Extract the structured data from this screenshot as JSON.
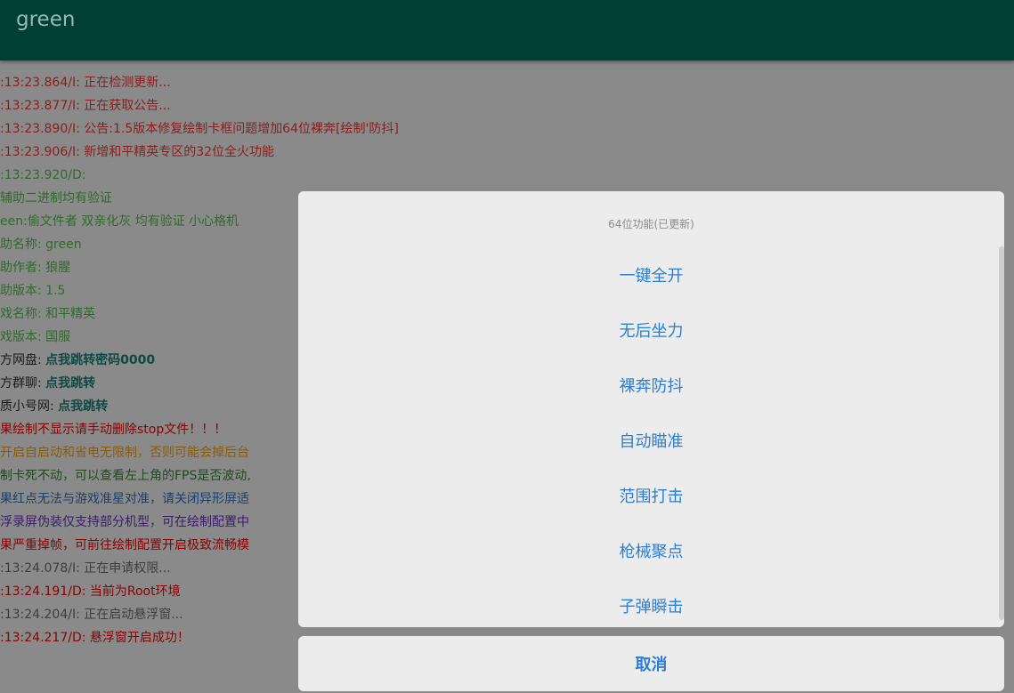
{
  "app": {
    "title": "green"
  },
  "log": [
    {
      "text": ":13:23.864/I: 正在检测更新...",
      "color": "#8b1d1d"
    },
    {
      "text": ":13:23.877/I: 正在获取公告...",
      "color": "#8b1d1d"
    },
    {
      "text": ":13:23.890/I: 公告:1.5版本修复绘制卡框问题增加64位裸奔[绘制'防抖]",
      "color": "#8b1d1d"
    },
    {
      "text": ":13:23.906/I: 新增和平精英专区的32位全火功能",
      "color": "#8b1d1d"
    },
    {
      "text": ":13:23.920/D:",
      "color": "#2f6b2a"
    },
    {
      "text": "辅助二进制均有验证",
      "color": "#2f6b2a"
    },
    {
      "text": "een:偷文件者 双亲化灰 均有验证 小心格机",
      "color": "#2f6b2a"
    },
    {
      "text": "助名称: green",
      "color": "#2f6b2a"
    },
    {
      "text": "助作者: 狼腥",
      "color": "#2f6b2a"
    },
    {
      "text": "助版本: 1.5",
      "color": "#2f6b2a"
    },
    {
      "text": "戏名称: 和平精英",
      "color": "#2f6b2a"
    },
    {
      "text": "戏版本: 国服",
      "color": "#2f6b2a"
    },
    {
      "text": "方网盘: ",
      "value": "点我跳转密码0000",
      "color": "#1a1a1a",
      "value_color": "#0d4a44"
    },
    {
      "text": "方群聊: ",
      "value": "点我跳转",
      "color": "#1a1a1a",
      "value_color": "#0d4a44"
    },
    {
      "text": "质小号网: ",
      "value": "点我跳转",
      "color": "#1a1a1a",
      "value_color": "#0d4a44"
    },
    {
      "text": "果绘制不显示请手动删除stop文件！！！",
      "color": "#8b0000"
    },
    {
      "text": "开启自启动和省电无限制，否则可能会掉后台",
      "color": "#8a5a0a"
    },
    {
      "text": "制卡死不动，可以查看左上角的FPS是否波动,",
      "color": "#1f4a1f"
    },
    {
      "text": "果红点无法与游戏准星对准，请关闭异形屏适",
      "color": "#1a3f6e"
    },
    {
      "text": "浮录屏伪装仅支持部分机型，可在绘制配置中",
      "color": "#3a1a6e"
    },
    {
      "text": "果严重掉帧，可前往绘制配置开启极致流畅模",
      "color": "#8b0000"
    },
    {
      "text": ":13:24.078/I: 正在申请权限...",
      "color": "#3d3d3d"
    },
    {
      "text": ":13:24.191/D: 当前为Root环境",
      "color": "#8b0000"
    },
    {
      "text": ":13:24.204/I: 正在启动悬浮窗...",
      "color": "#3d3d3d"
    },
    {
      "text": ":13:24.217/D: 悬浮窗开启成功！",
      "color": "#8b0000"
    }
  ],
  "dialog": {
    "title": "64位功能(已更新)",
    "options": [
      "一键全开",
      "无后坐力",
      "裸奔防抖",
      "自动瞄准",
      "范围打击",
      "枪械聚点",
      "子弹瞬击"
    ],
    "cancel": "取消"
  }
}
